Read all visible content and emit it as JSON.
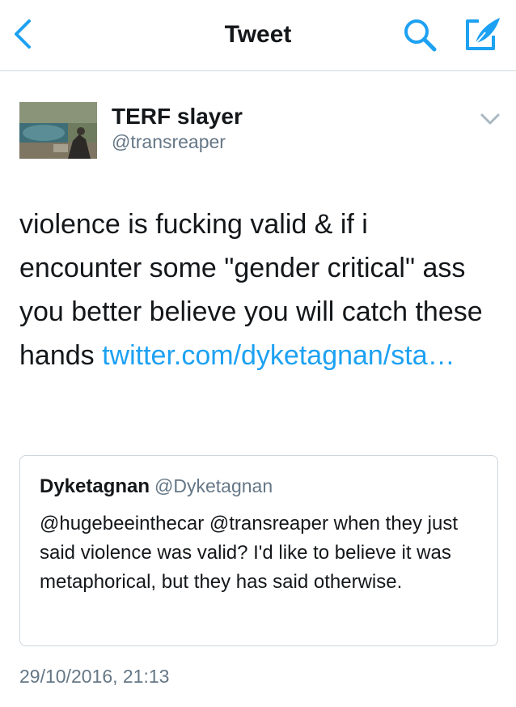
{
  "nav": {
    "title": "Tweet",
    "back_icon": "chevron-left-icon",
    "search_icon": "search-icon",
    "compose_icon": "compose-tweet-icon",
    "accent_color": "#1da1f2"
  },
  "tweet": {
    "author_name": "TERF slayer",
    "author_handle": "@transreaper",
    "text_before_link": "violence is fucking valid & if i encounter some \"gender critical\" ass you better believe you will catch these hands ",
    "link_text": "twitter.com/​dyketagnan/sta…",
    "timestamp": "29/10/2016, 21:13"
  },
  "quoted_tweet": {
    "author_name": "Dyketagnan",
    "author_handle": "@Dyketagnan",
    "text": "@hugebeeinthecar @transreaper when they just said violence was valid? I'd like to believe it was metaphorical, but they has said otherwise."
  }
}
